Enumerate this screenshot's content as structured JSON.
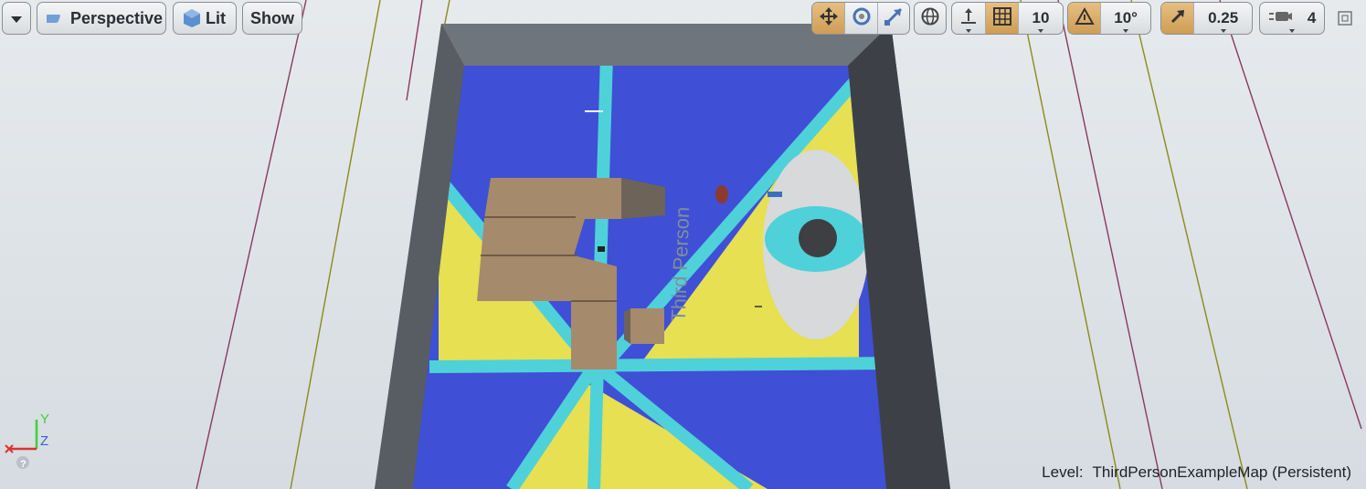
{
  "toolbar": {
    "menu_icon": "chevron-down-icon",
    "perspective_label": "Perspective",
    "lit_label": "Lit",
    "show_label": "Show"
  },
  "transform_tools": {
    "translate": {
      "icon": "move-icon",
      "active": true
    },
    "rotate": {
      "icon": "rotate-icon",
      "active": false
    },
    "scale": {
      "icon": "scale-icon",
      "active": false
    },
    "world_local": {
      "icon": "globe-icon"
    },
    "surface_snap": {
      "icon": "surface-snap-icon"
    }
  },
  "grid_snap": {
    "icon": "grid-icon",
    "active": true,
    "value": "10"
  },
  "rotation_snap": {
    "icon": "angle-icon",
    "active": true,
    "value": "10°"
  },
  "scale_snap": {
    "icon": "scale-snap-icon",
    "active": true,
    "value": "0.25"
  },
  "camera_speed": {
    "icon": "camera-speed-icon",
    "value": "4"
  },
  "maximize": {
    "icon": "maximize-icon"
  },
  "scene": {
    "floor_text": "Third Person"
  },
  "level": {
    "label": "Level:",
    "name": "ThirdPersonExampleMap (Persistent)"
  },
  "axis_labels": {
    "y": "Y",
    "z": "Z"
  },
  "help_icon": "question-icon",
  "colors": {
    "floor_blue": "#3f4fd6",
    "floor_yellow": "#e6e052",
    "cyan": "#4fd1d9",
    "wall": "#5b6068",
    "wood": "#a58a6c",
    "toolbar_active": "#d7a862",
    "background": "#dfe4e8"
  }
}
